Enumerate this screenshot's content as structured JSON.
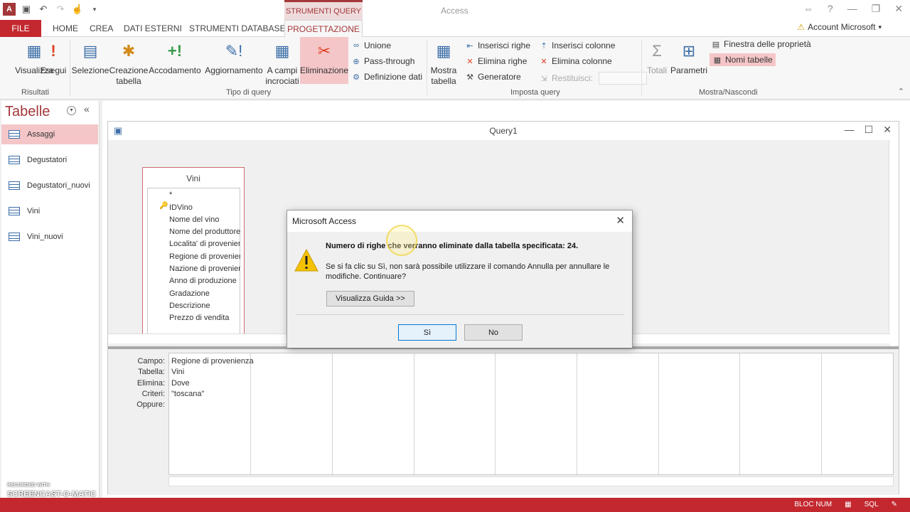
{
  "title_bar": {
    "app_title": "Access",
    "context_tab": "STRUMENTI QUERY"
  },
  "tabs": [
    "FILE",
    "HOME",
    "CREA",
    "DATI ESTERNI",
    "STRUMENTI DATABASE",
    "PROGETTAZIONE"
  ],
  "account": "Account Microsoft",
  "ribbon": {
    "results": {
      "buttons": [
        "Visualizza",
        "Esegui"
      ],
      "label": "Risultati"
    },
    "query_type": {
      "buttons": [
        "Selezione",
        "Creazione tabella",
        "Accodamento",
        "Aggiornamento",
        "A campi incrociati",
        "Eliminazione"
      ],
      "small": [
        "Unione",
        "Pass-through",
        "Definizione dati"
      ],
      "label": "Tipo di query"
    },
    "setup": {
      "show_table": "Mostra tabella",
      "small_left": [
        "Inserisci righe",
        "Elimina righe",
        "Generatore"
      ],
      "small_right": [
        "Inserisci colonne",
        "Elimina colonne",
        "Restituisci:"
      ],
      "label": "Imposta query"
    },
    "show_hide": {
      "buttons": [
        "Totali",
        "Parametri"
      ],
      "small": [
        "Finestra delle proprietà",
        "Nomi tabelle"
      ],
      "label": "Mostra/Nascondi"
    }
  },
  "nav": {
    "title": "Tabelle",
    "items": [
      "Assaggi",
      "Degustatori",
      "Degustatori_nuovi",
      "Vini",
      "Vini_nuovi"
    ]
  },
  "query": {
    "window_title": "Query1",
    "table_name": "Vini",
    "fields": [
      "*",
      "IDVino",
      "Nome del vino",
      "Nome del produttore",
      "Localita' di provenienza",
      "Regione di provenienza",
      "Nazione di provenienza",
      "Anno di produzione",
      "Gradazione",
      "Descrizione",
      "Prezzo di vendita"
    ],
    "row_labels": [
      "Campo:",
      "Tabella:",
      "Elimina:",
      "Criteri:",
      "Oppure:"
    ],
    "column1": [
      "Regione di provenienza",
      "Vini",
      "Dove",
      "\"toscana\"",
      ""
    ]
  },
  "dialog": {
    "title": "Microsoft Access",
    "message_bold": "Numero di righe che verranno eliminate dalla tabella specificata: 24.",
    "message": "Se si fa clic su Sì, non sarà possibile utilizzare il comando Annulla per annullare le modifiche. Continuare?",
    "guide_button": "Visualizza Guida >>",
    "yes_button": "Sì",
    "no_button": "No"
  },
  "status": {
    "num_lock": "BLOC NUM",
    "sql": "SQL"
  },
  "watermark": [
    "RECORDED WITH",
    "SCREENCAST-O-MATIC"
  ],
  "colors": {
    "accent": "#a4373a",
    "file_tab": "#c3282f",
    "highlight": "#f4c6c8"
  }
}
